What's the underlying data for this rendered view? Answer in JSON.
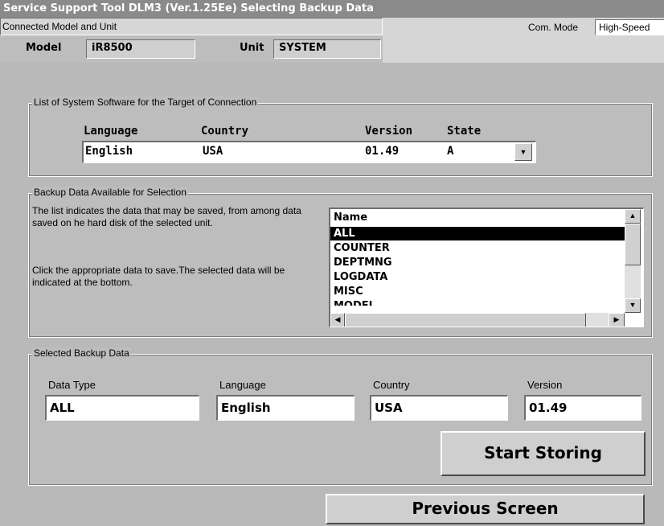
{
  "window": {
    "title": "Service Support Tool DLM3 (Ver.1.25Ee) Selecting Backup Data"
  },
  "connection": {
    "label": "Connected Model and Unit",
    "com_mode_label": "Com. Mode",
    "com_mode_value": "High-Speed",
    "model_label": "Model",
    "model_value": "iR8500",
    "unit_label": "Unit",
    "unit_value": "SYSTEM"
  },
  "system_software": {
    "title": "List of System Software for the Target of Connection",
    "headers": {
      "language": "Language",
      "country": "Country",
      "version": "Version",
      "state": "State"
    },
    "selected": {
      "language": "English",
      "country": "USA",
      "version": "01.49",
      "state": "A"
    }
  },
  "backup_available": {
    "title": "Backup Data Available for Selection",
    "description_1": "The list indicates the data that may be saved, from among data saved on he hard disk of the selected unit.",
    "description_2": "Click the appropriate data to save.The selected data will be indicated at the bottom.",
    "list_header": "Name",
    "items": [
      "ALL",
      "COUNTER",
      "DEPTMNG",
      "LOGDATA",
      "MISC",
      "MODEL"
    ],
    "selected_item": "ALL"
  },
  "selected_backup": {
    "title": "Selected Backup Data",
    "data_type_label": "Data Type",
    "data_type_value": "ALL",
    "language_label": "Language",
    "language_value": "English",
    "country_label": "Country",
    "country_value": "USA",
    "version_label": "Version",
    "version_value": "01.49"
  },
  "buttons": {
    "start_storing": "Start Storing",
    "previous_screen": "Previous Screen"
  }
}
